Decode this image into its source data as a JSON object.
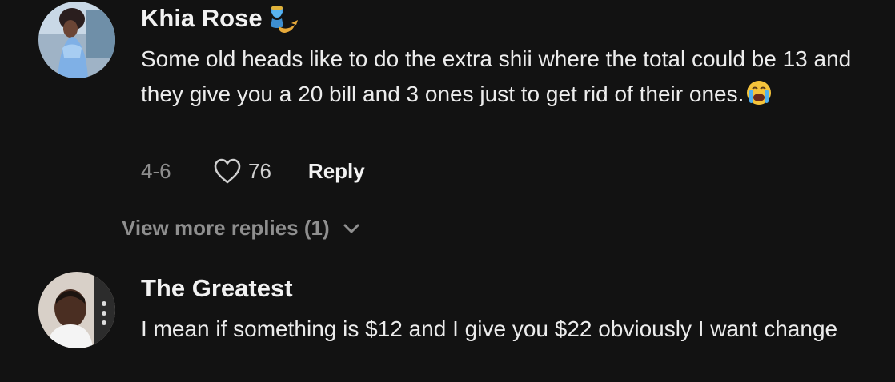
{
  "colors": {
    "background": "#121212",
    "username": "#f2f2f2",
    "body_text": "#ececec",
    "meta_text": "#8e8e8e"
  },
  "comments": [
    {
      "username": "Khia Rose",
      "username_emoji": "genie-emoji",
      "text": "Some old heads like to do the extra shii where the total could be 13 and they give you a 20 bill and 3 ones just to get rid of their ones.",
      "text_emoji": "loudly-crying-face-emoji",
      "date": "4-6",
      "likes": "76",
      "reply_label": "Reply",
      "view_more_label": "View more replies (1)"
    },
    {
      "username": "The Greatest",
      "text": "I mean if something is $12 and I give you $22 obviously I want change"
    }
  ]
}
